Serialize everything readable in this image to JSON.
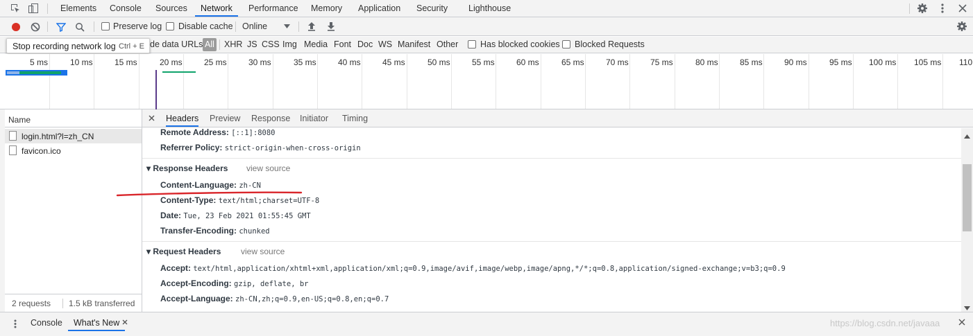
{
  "main_tabs": [
    "Elements",
    "Console",
    "Sources",
    "Network",
    "Performance",
    "Memory",
    "Application",
    "Security",
    "Lighthouse"
  ],
  "active_tab": "Network",
  "toolbar": {
    "preserve_log": "Preserve log",
    "disable_cache": "Disable cache",
    "throttling": "Online"
  },
  "tooltip": {
    "text": "Stop recording network log",
    "shortcut": "Ctrl + E"
  },
  "filter": {
    "hide_data_urls": "de data URLs",
    "types": [
      "All",
      "XHR",
      "JS",
      "CSS",
      "Img",
      "Media",
      "Font",
      "Doc",
      "WS",
      "Manifest",
      "Other"
    ],
    "has_blocked_cookies": "Has blocked cookies",
    "blocked_requests": "Blocked Requests"
  },
  "timeline": {
    "ticks": [
      "5 ms",
      "10 ms",
      "15 ms",
      "20 ms",
      "25 ms",
      "30 ms",
      "35 ms",
      "40 ms",
      "45 ms",
      "50 ms",
      "55 ms",
      "60 ms",
      "65 ms",
      "70 ms",
      "75 ms",
      "80 ms",
      "85 ms",
      "90 ms",
      "95 ms",
      "100 ms",
      "105 ms",
      "110"
    ]
  },
  "requests": {
    "header": "Name",
    "items": [
      "login.html?l=zh_CN",
      "favicon.ico"
    ],
    "summary_count": "2 requests",
    "summary_transfer": "1.5 kB transferred"
  },
  "details": {
    "tabs": [
      "Headers",
      "Preview",
      "Response",
      "Initiator",
      "Timing"
    ],
    "general": [
      {
        "key": "Remote Address:",
        "value": "[::1]:8080"
      },
      {
        "key": "Referrer Policy:",
        "value": "strict-origin-when-cross-origin"
      }
    ],
    "response_title": "Response Headers",
    "response_view_source": "view source",
    "response_headers": [
      {
        "key": "Content-Language:",
        "value": "zh-CN"
      },
      {
        "key": "Content-Type:",
        "value": "text/html;charset=UTF-8"
      },
      {
        "key": "Date:",
        "value": "Tue, 23 Feb 2021 01:55:45 GMT"
      },
      {
        "key": "Transfer-Encoding:",
        "value": "chunked"
      }
    ],
    "request_title": "Request Headers",
    "request_view_source": "view source",
    "request_headers": [
      {
        "key": "Accept:",
        "value": "text/html,application/xhtml+xml,application/xml;q=0.9,image/avif,image/webp,image/apng,*/*;q=0.8,application/signed-exchange;v=b3;q=0.9"
      },
      {
        "key": "Accept-Encoding:",
        "value": "gzip, deflate, br"
      },
      {
        "key": "Accept-Language:",
        "value": "zh-CN,zh;q=0.9,en-US;q=0.8,en;q=0.7"
      }
    ]
  },
  "drawer": {
    "tabs": [
      "Console",
      "What's New"
    ],
    "watermark": "https://blog.csdn.net/javaaa"
  },
  "colors": {
    "accent": "#1a73e8",
    "record": "#d93025",
    "annotation": "#d9262b"
  }
}
